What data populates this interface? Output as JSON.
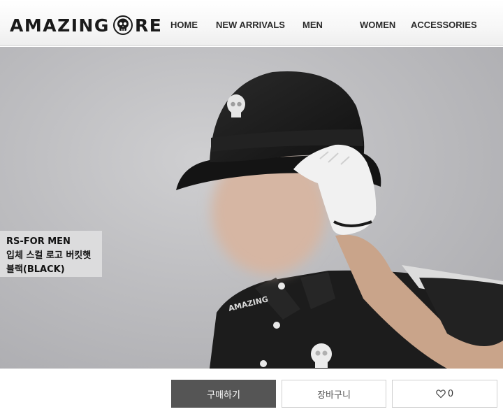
{
  "brand": {
    "logo_left": "AMAZING",
    "logo_right": "RE",
    "logo_icon": "skull-icon"
  },
  "nav": {
    "items": [
      "HOME",
      "NEW ARRIVALS",
      "MEN",
      "WOMEN",
      "ACCESSORIES"
    ]
  },
  "hero": {
    "caption_line1": "RS-FOR MEN",
    "caption_line2": "입체 스컬 로고 버킷햇",
    "caption_line3": "블랙(BLACK)",
    "shirt_print": "AMAZING"
  },
  "actions": {
    "buy_label": "구매하기",
    "cart_label": "장바구니",
    "like_icon": "heart-icon",
    "like_count": "0"
  },
  "colors": {
    "buy_button": "#555555",
    "text_dark": "#1a1a1a"
  }
}
